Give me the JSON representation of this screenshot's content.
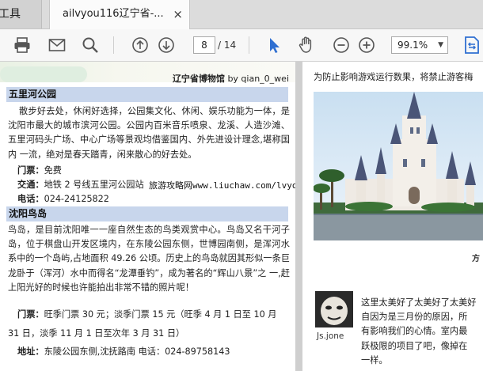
{
  "tabs": {
    "left_tab_label": "工具",
    "active_tab_label": "ailvyou116辽宁省-...",
    "close_symbol": "×"
  },
  "toolbar": {
    "icons": [
      "print-icon",
      "email-icon",
      "search-icon",
      "prev-page-icon",
      "next-page-icon",
      "select-tool-icon",
      "hand-tool-icon",
      "zoom-out-icon",
      "zoom-in-icon",
      "fit-page-icon"
    ],
    "current_page": "8",
    "total_pages": "/ 14",
    "zoom": "99.1%",
    "zoom_caret": "▼",
    "accent_color": "#2f6fd1"
  },
  "page_left": {
    "caption_place": "辽宁省博物馆",
    "caption_by": "by qian_0_wei",
    "section1": {
      "title": "五里河公园",
      "body": "散步好去处，休闲好选择，公园集文化、休闲、娱乐功能为一体，是 沈阳市最大的城市滨河公园。公园内百米音乐喷泉、龙溪、人造沙滩、五里河码头广场、中心广场等景观均借鉴国内、外先进设计理念,堪称国内 一流，绝对是春天踏青，闲来散心的好去处。",
      "ticket_label": "门票：",
      "ticket_value": "免费",
      "transport_label": "交通：",
      "transport_value": "地铁 2 号线五里河公园站",
      "phone_label": "电话：",
      "phone_value": "024-24125822"
    },
    "watermark": "旅游攻略网www.liuchaw.com/lvyou/ailvyou",
    "section2": {
      "title": "沈阳鸟岛",
      "body": "鸟岛，是目前沈阳唯一一座自然生态的鸟类观赏中心。鸟岛又名干河子岛，位于棋盘山开发区境内，在东陵公园东侧，世博园南侧，是浑河水 系中的一个岛屿,占地面积 49.26 公顷。历史上的鸟岛就因其形似一条巨龙卧于（浑河）水中而得名“龙潭垂钓”，成为著名的“辉山八景”之 一,赶上阳光好的时候也许能拍出非常不错的照片呢！",
      "ticket_label": "门票：",
      "ticket_line1": "旺季门票 30 元；淡季门票 15 元（旺季 4 月 1 日至 10 月",
      "ticket_line2": "31 日，淡季 11 月 1 日至次年 3 月 31 日）",
      "address_label": "地址：",
      "address_value": "东陵公园东侧,沈抚路南  电话：024-89758143"
    }
  },
  "page_right": {
    "top_text": "为防止影响游戏运行数果，将禁止游客梅",
    "photo_caption": "方",
    "avatar_name": "Js.jone",
    "comment_lines": [
      "这里太美好了太美好了太美好",
      "自因为是三月份的原因，所",
      "有影响我们的心情。室内最",
      "跃极限的项目了吧，像掉在",
      "一样。"
    ]
  }
}
